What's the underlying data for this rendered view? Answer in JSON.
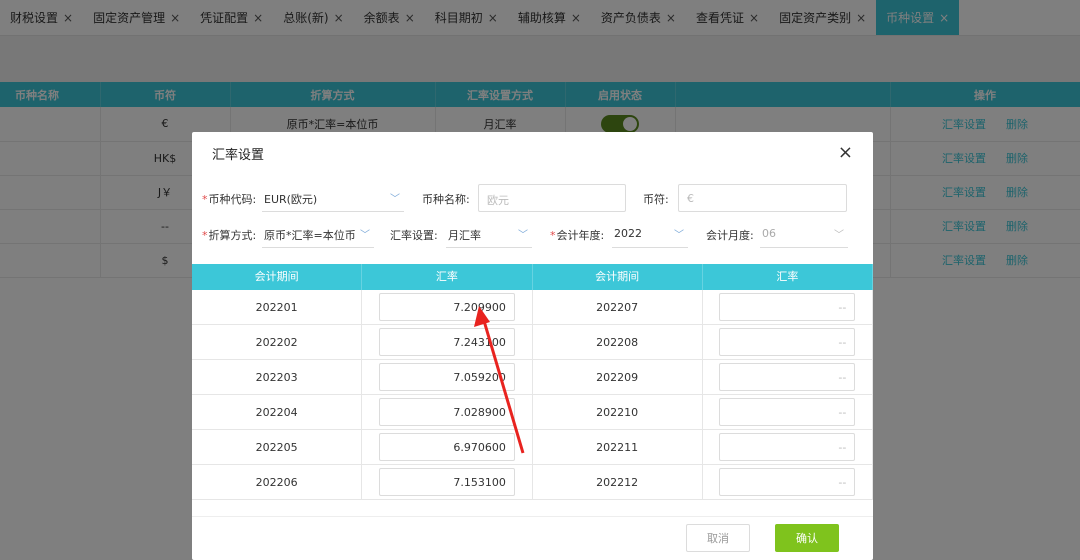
{
  "tabs": [
    {
      "label": "财税设置",
      "close": "×"
    },
    {
      "label": "固定资产管理",
      "close": "×"
    },
    {
      "label": "凭证配置",
      "close": "×"
    },
    {
      "label": "总账(新)",
      "close": "×"
    },
    {
      "label": "余额表",
      "close": "×"
    },
    {
      "label": "科目期初",
      "close": "×"
    },
    {
      "label": "辅助核算",
      "close": "×"
    },
    {
      "label": "资产负债表",
      "close": "×"
    },
    {
      "label": "查看凭证",
      "close": "×"
    },
    {
      "label": "固定资产类别",
      "close": "×"
    },
    {
      "label": "币种设置",
      "close": "×",
      "active": true
    }
  ],
  "bg_table": {
    "headers": [
      "币种名称",
      "币符",
      "折算方式",
      "汇率设置方式",
      "启用状态",
      "",
      "操作"
    ],
    "rows": [
      {
        "symbol": "€",
        "method": "原币*汇率=本位币",
        "rate_mode": "月汇率"
      },
      {
        "symbol": "HK$"
      },
      {
        "symbol": "J￥"
      },
      {
        "symbol": "--"
      },
      {
        "symbol": "$"
      }
    ],
    "action_rate": "汇率设置",
    "action_delete": "删除"
  },
  "dialog": {
    "title": "汇率设置",
    "close": "×",
    "form": {
      "currency_code_label": "币种代码:",
      "currency_code_value": "EUR(欧元)",
      "currency_name_label": "币种名称:",
      "currency_name_placeholder": "欧元",
      "symbol_label": "币符:",
      "symbol_placeholder": "€",
      "conversion_label": "折算方式:",
      "conversion_value": "原币*汇率=本位币",
      "rate_setting_label": "汇率设置:",
      "rate_setting_value": "月汇率",
      "fiscal_year_label": "会计年度:",
      "fiscal_year_value": "2022",
      "fiscal_month_label": "会计月度:",
      "fiscal_month_value": "06",
      "required_mark": "*"
    },
    "table": {
      "headers": [
        "会计期间",
        "汇率",
        "会计期间",
        "汇率"
      ],
      "rows": [
        {
          "p1": "202201",
          "r1": "7.209900",
          "p2": "202207",
          "r2": "--"
        },
        {
          "p1": "202202",
          "r1": "7.243100",
          "p2": "202208",
          "r2": "--"
        },
        {
          "p1": "202203",
          "r1": "7.059200",
          "p2": "202209",
          "r2": "--"
        },
        {
          "p1": "202204",
          "r1": "7.028900",
          "p2": "202210",
          "r2": "--"
        },
        {
          "p1": "202205",
          "r1": "6.970600",
          "p2": "202211",
          "r2": "--"
        },
        {
          "p1": "202206",
          "r1": "7.153100",
          "p2": "202212",
          "r2": "--"
        }
      ]
    },
    "cancel_label": "取消",
    "ok_label": "确认"
  },
  "colors": {
    "accent": "#3cc7d8",
    "confirm": "#7fc31d",
    "arrow": "#e8231f"
  }
}
